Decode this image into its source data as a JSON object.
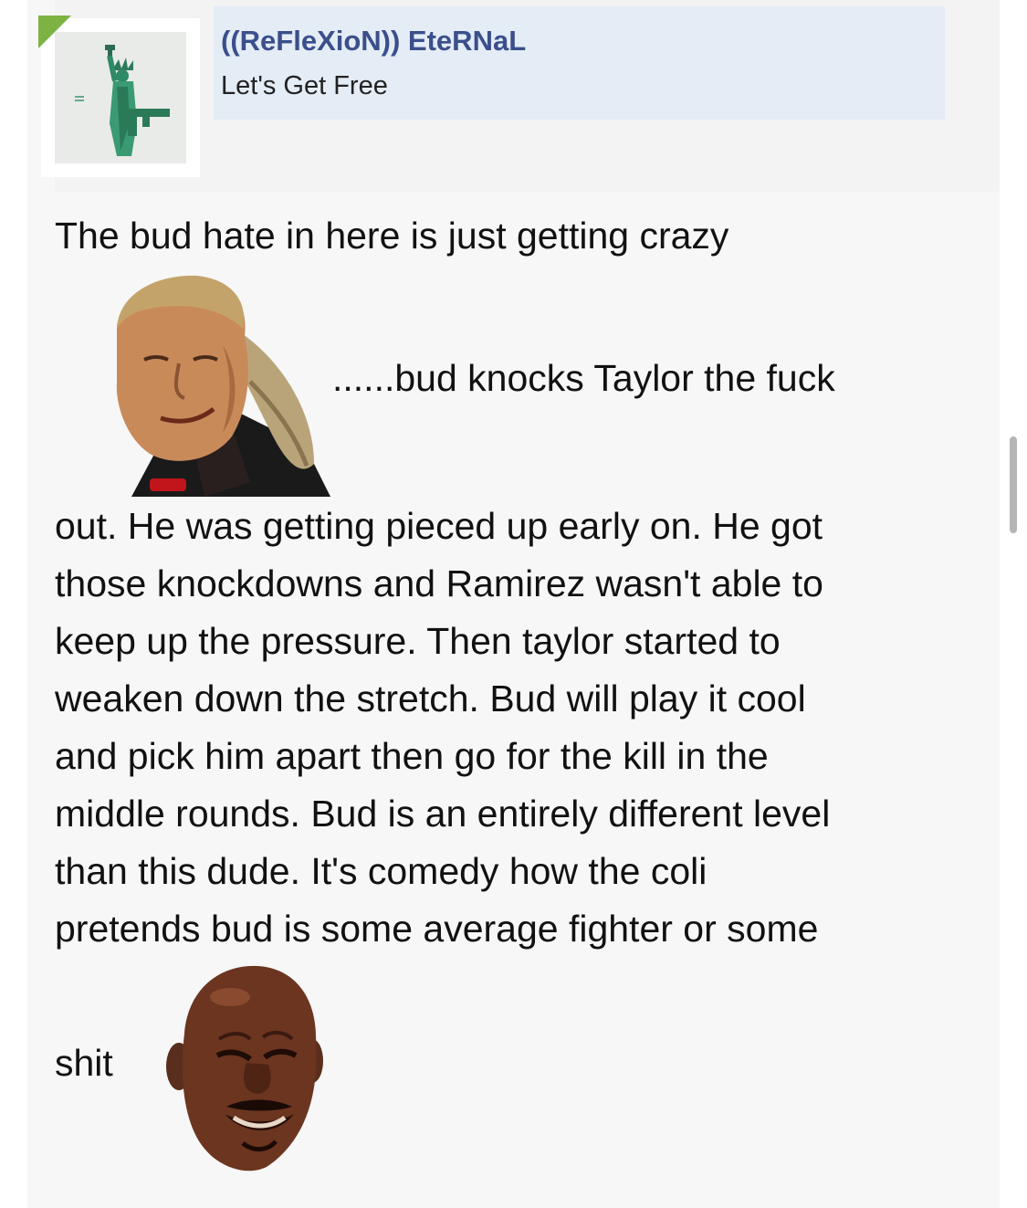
{
  "user": {
    "name": "((ReFleXioN)) EteRNaL",
    "title": "Let's Get Free",
    "avatar_icon": "statue-of-liberty-with-gun-icon",
    "flag_color": "#7cb342"
  },
  "post": {
    "line1": "The bud hate in here is just getting crazy",
    "line2": "......bud knocks Taylor the fuck",
    "lines": [
      "out. He was getting pieced up early on. He got",
      "those knockdowns and Ramirez wasn't able to",
      "keep up the pressure. Then taylor started to",
      "weaken down the stretch. Bud will play it cool",
      "and pick him apart then go for the kill in the",
      "middle rounds. Bud is an entirely different level",
      "than this dude. It's comedy how the coli",
      "pretends bud is some average fighter or some"
    ],
    "last_word": "shit",
    "emojis": [
      "smirking-wrestler-emoji",
      "crying-jordan-emoji"
    ]
  },
  "colors": {
    "username": "#3a4f8b",
    "user_box_bg": "#e4ecf6",
    "post_bg": "#f7f7f7"
  }
}
